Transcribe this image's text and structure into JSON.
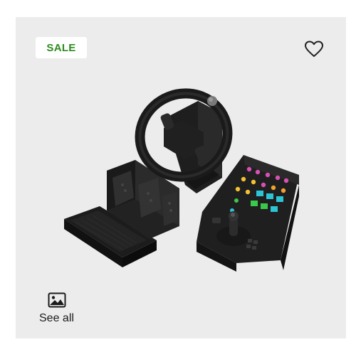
{
  "badge": {
    "label": "SALE",
    "color": "#2e8b1e"
  },
  "favorite": {
    "icon": "heart-icon"
  },
  "product_image": {
    "icon": "farm-sim-controller-image"
  },
  "see_all": {
    "label": "See all",
    "icon": "image-gallery-icon"
  },
  "colors": {
    "background": "#ececec",
    "text": "#1b1b1b"
  }
}
